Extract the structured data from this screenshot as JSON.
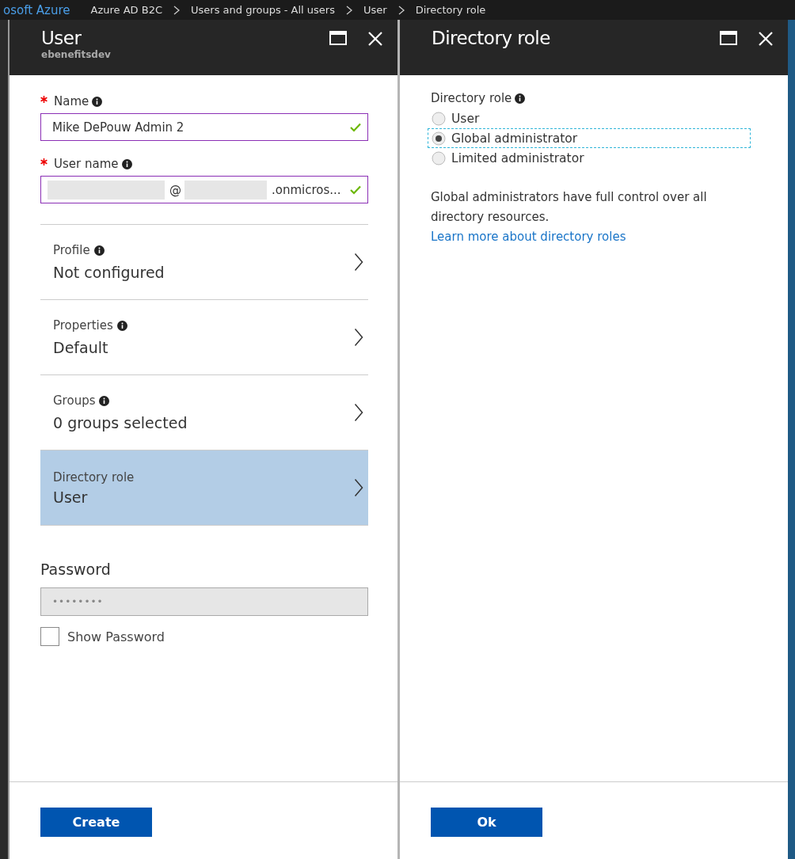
{
  "breadcrumb": [
    {
      "text": "osoft Azure",
      "kind": "brand"
    },
    {
      "text": "Azure AD B2C",
      "kind": "crumb"
    },
    {
      "text": "Users and groups - All users",
      "kind": "crumb"
    },
    {
      "text": "User",
      "kind": "crumb"
    },
    {
      "text": "Directory role",
      "kind": "crumb"
    }
  ],
  "user_blade": {
    "title": "User",
    "subtitle": "ebenefitsdev",
    "fields": [
      {
        "label": "Name",
        "required": true,
        "valid": true,
        "parts": [
          {
            "kind": "text",
            "text": "Mike DePouw Admin 2"
          }
        ]
      },
      {
        "label": "User name",
        "required": true,
        "valid": true,
        "parts": [
          {
            "kind": "redacted"
          },
          {
            "kind": "text",
            "text": "@"
          },
          {
            "kind": "redacted"
          },
          {
            "kind": "text",
            "text": ".onmicros..."
          }
        ]
      }
    ],
    "nav_items": [
      {
        "label": "Profile",
        "info": true,
        "value": "Not configured",
        "selected": false
      },
      {
        "label": "Properties",
        "info": true,
        "value": "Default",
        "selected": false
      },
      {
        "label": "Groups",
        "info": true,
        "value": "0 groups selected",
        "selected": false
      },
      {
        "label": "Directory role",
        "info": false,
        "value": "User",
        "selected": true
      }
    ],
    "password": {
      "label": "Password",
      "value": "••••••••",
      "disabled": true
    },
    "show_password": {
      "label": "Show Password",
      "checked": false
    },
    "button": "Create"
  },
  "role_blade": {
    "title": "Directory role",
    "label": "Directory role",
    "options": [
      {
        "label": "User",
        "selected": false
      },
      {
        "label": "Global administrator",
        "selected": true
      },
      {
        "label": "Limited administrator",
        "selected": false
      }
    ],
    "description": "Global administrators have full control over all directory resources.",
    "link": "Learn more about directory roles",
    "button": "Ok"
  }
}
